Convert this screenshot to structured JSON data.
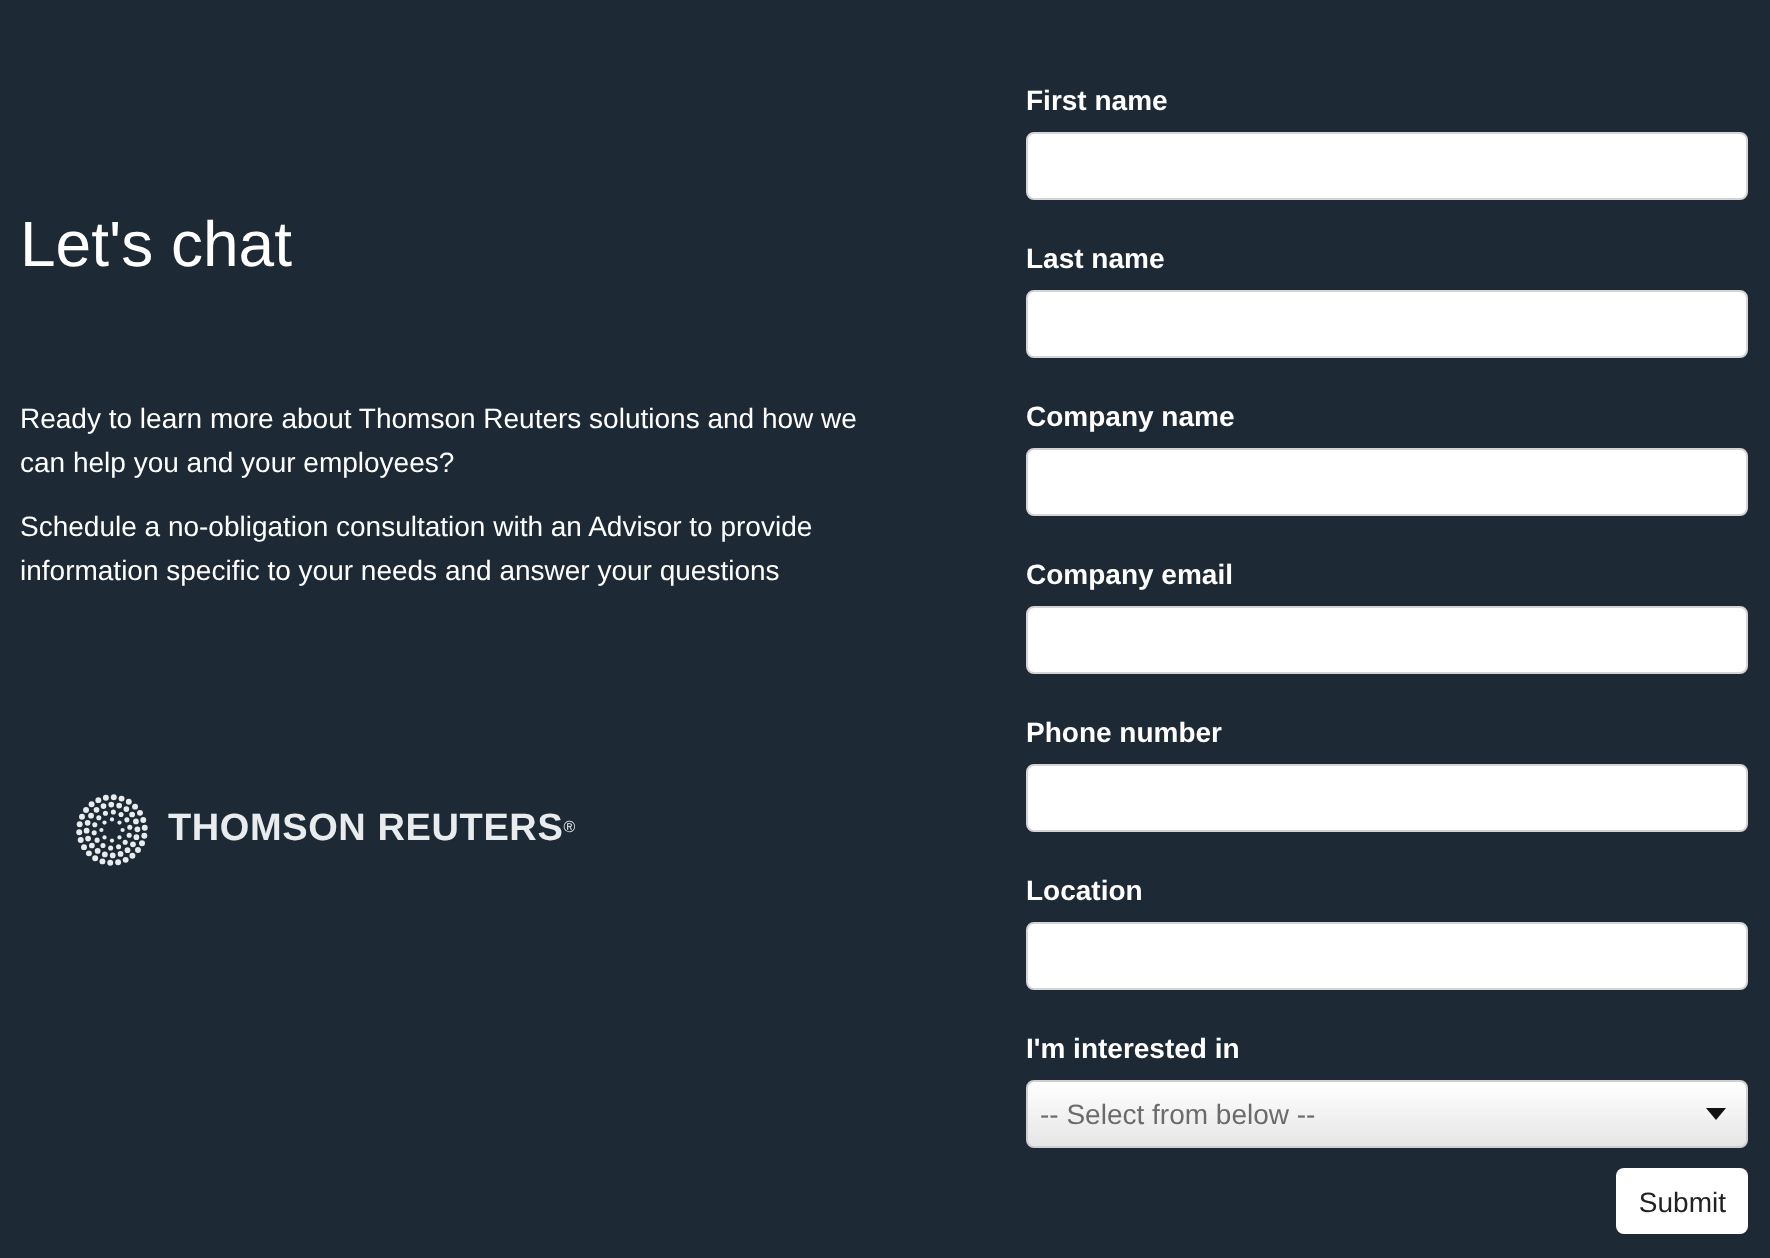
{
  "intro": {
    "heading": "Let's chat",
    "paragraphs": [
      "Ready to learn more about Thomson Reuters solutions and how we can help you and your employees?",
      "Schedule a no-obligation consultation with an Advisor to provide information specific to your needs and answer your questions"
    ]
  },
  "logo": {
    "text": "THOMSON REUTERS$^{®}$"
  },
  "form": {
    "fields": [
      {
        "label": "First name",
        "kind": "text"
      },
      {
        "label": "Last name",
        "kind": "text"
      },
      {
        "label": "Company name",
        "kind": "text"
      },
      {
        "label": "Company email",
        "kind": "text"
      },
      {
        "label": "Phone number",
        "kind": "text"
      },
      {
        "label": "Location",
        "kind": "text"
      },
      {
        "label": "I'm interested in",
        "kind": "select",
        "placeholder": "-- Select from below --"
      }
    ],
    "submit": {
      "label": "Submit"
    }
  }
}
